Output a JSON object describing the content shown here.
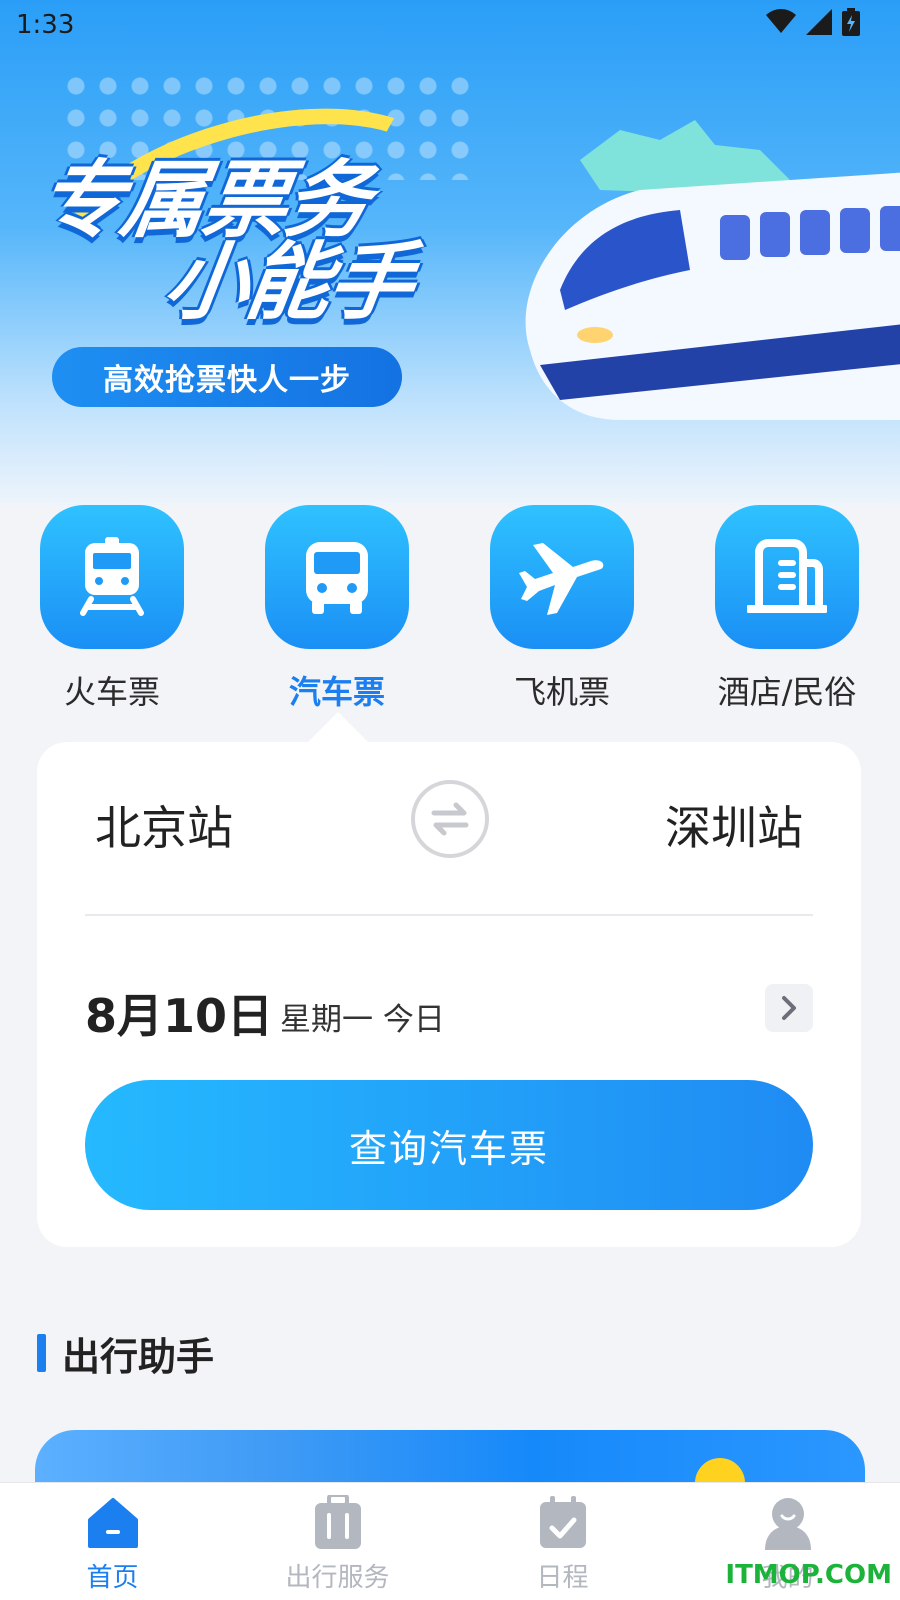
{
  "status_bar": {
    "time": "1:33"
  },
  "banner": {
    "title_line1": "专属票务",
    "title_line2": "小能手",
    "slogan": "高效抢票快人一步"
  },
  "categories": [
    {
      "label": "火车票",
      "icon": "train-icon",
      "active": false
    },
    {
      "label": "汽车票",
      "icon": "bus-icon",
      "active": true
    },
    {
      "label": "飞机票",
      "icon": "plane-icon",
      "active": false
    },
    {
      "label": "酒店/民俗",
      "icon": "hotel-icon",
      "active": false
    }
  ],
  "search": {
    "from_station": "北京站",
    "to_station": "深圳站",
    "date": "8月10日",
    "date_detail": "星期一 今日",
    "button_label": "查询汽车票"
  },
  "assistant": {
    "title": "出行助手"
  },
  "bottom_nav": [
    {
      "label": "首页",
      "icon": "home-icon",
      "active": true
    },
    {
      "label": "出行服务",
      "icon": "luggage-icon",
      "active": false
    },
    {
      "label": "日程",
      "icon": "calendar-icon",
      "active": false
    },
    {
      "label": "我的",
      "icon": "profile-icon",
      "active": false
    }
  ],
  "watermark": "ITMOP.COM",
  "colors": {
    "accent": "#1b7ff0",
    "button_start": "#25b9ff",
    "button_end": "#1f8bf3",
    "inactive": "#b3b7bf"
  }
}
